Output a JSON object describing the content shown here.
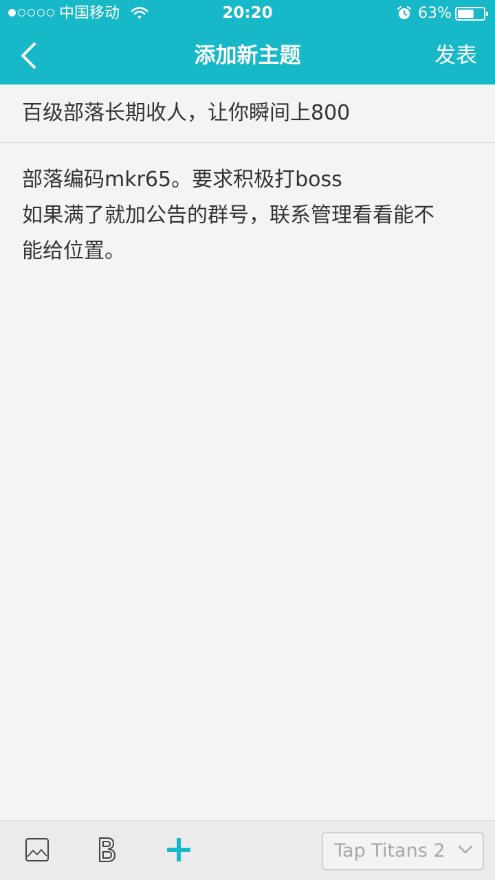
{
  "status_bar": {
    "carrier": "中国移动",
    "time": "20:20",
    "battery_percent": "63%",
    "signal_strength": 1,
    "battery_level": 0.63
  },
  "nav": {
    "title": "添加新主题",
    "publish_label": "发表",
    "back_icon": "chevron-left-icon"
  },
  "post": {
    "title": "百级部落长期收人，让你瞬间上800",
    "body_lines": [
      "部落编码mkr65。要求积极打boss",
      "如果满了就加公告的群号，联系管理看看能不",
      "能给位置。"
    ]
  },
  "toolbar": {
    "image_icon": "image-icon",
    "bold_icon": "bold-icon",
    "add_icon": "plus-icon",
    "category_selected": "Tap Titans 2"
  },
  "colors": {
    "accent": "#17b8c8",
    "text": "#333333",
    "placeholder": "#a8a8a8",
    "background": "#f4f4f4"
  }
}
